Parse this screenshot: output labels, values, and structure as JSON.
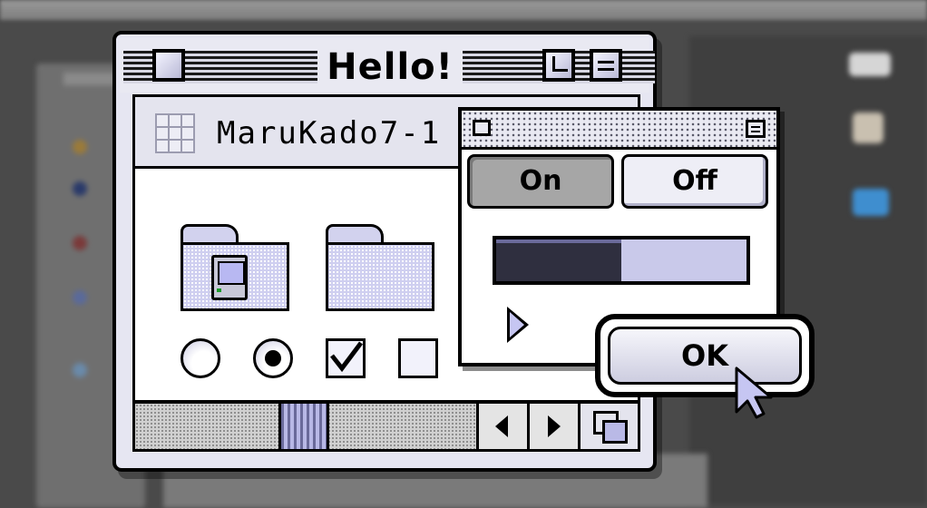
{
  "main_window": {
    "title": "Hello!",
    "header_title": "MaruKado7-1",
    "folders": [
      {
        "name": "system-folder"
      },
      {
        "name": "empty-folder"
      }
    ],
    "controls": {
      "radio_off": false,
      "radio_on": true,
      "checkbox_on": true,
      "checkbox_off": false
    }
  },
  "palette": {
    "buttons": [
      {
        "label": "On",
        "pressed": true
      },
      {
        "label": "Off",
        "pressed": false
      }
    ],
    "progress": 0.5
  },
  "dialog": {
    "ok_label": "OK"
  },
  "colors": {
    "accent": "#c6c6f2",
    "window_bg": "#e6e6f2",
    "desktop": "#4a4a4a"
  },
  "icons": [
    "close-box-icon",
    "zoom-box-icon",
    "collapse-box-icon",
    "grid-view-icon",
    "folder-icon",
    "mac-computer-icon",
    "scroll-left-arrow-icon",
    "scroll-right-arrow-icon",
    "grow-box-icon",
    "disclosure-triangle-icon",
    "arrow-cursor-icon"
  ]
}
